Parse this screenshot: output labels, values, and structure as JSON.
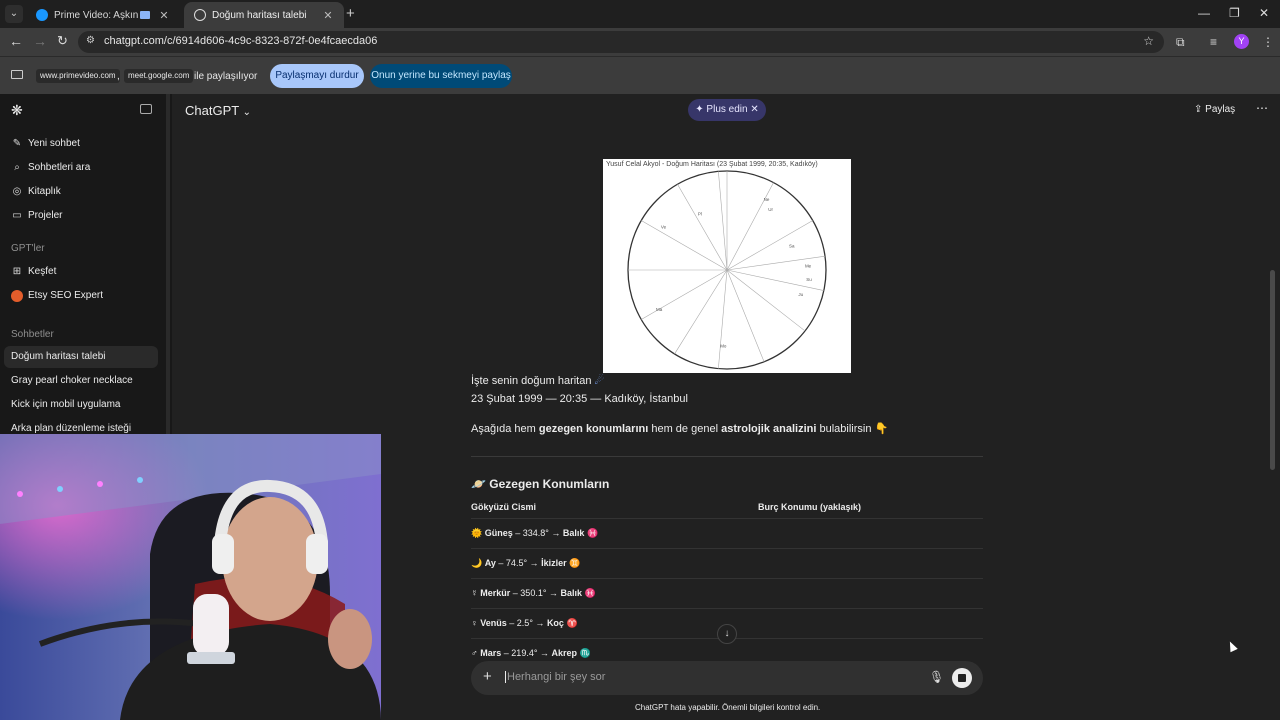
{
  "browser": {
    "tabs": [
      {
        "title": "Prime Video: Aşkın Gücü",
        "active": false
      },
      {
        "title": "Doğum haritası talebi",
        "active": true
      }
    ],
    "url": "chatgpt.com/c/6914d606-4c9c-8323-872f-0e4fcaecda06",
    "profile_initial": "Y"
  },
  "sharing": {
    "sites": [
      "www.primevideo.com",
      "meet.google.com"
    ],
    "separator": ",",
    "text": "ile paylaşılıyor",
    "stop_label": "Paylaşmayı durdur",
    "share_tab_label": "Onun yerine bu sekmeyi paylaş"
  },
  "sidebar": {
    "actions": [
      {
        "label": "Yeni sohbet",
        "icon": "edit-icon"
      },
      {
        "label": "Sohbetleri ara",
        "icon": "search-icon"
      },
      {
        "label": "Kitaplık",
        "icon": "library-icon"
      },
      {
        "label": "Projeler",
        "icon": "folder-icon"
      }
    ],
    "gpts_heading": "GPT'ler",
    "gpts": [
      {
        "label": "Keşfet",
        "icon": "grid-icon"
      },
      {
        "label": "Etsy SEO Expert",
        "icon": "etsy-icon"
      }
    ],
    "chats_heading": "Sohbetler",
    "chats": [
      {
        "label": "Doğum haritası talebi",
        "active": true
      },
      {
        "label": "Gray pearl choker necklace",
        "active": false
      },
      {
        "label": "Kick için mobil uygulama",
        "active": false
      },
      {
        "label": "Arka plan düzenleme isteği",
        "active": false
      }
    ]
  },
  "header": {
    "model": "ChatGPT",
    "plus_label": "Plus edin",
    "share_label": "Paylaş"
  },
  "chart_image": {
    "title": "Yusuf Celal Akyol - Doğum Haritası (23 Şubat 1999, 20:35, Kadıköy)",
    "planet_labels": [
      "Pl",
      "Ne",
      "Ur",
      "Sa",
      "Me",
      "Su",
      "Ju",
      "Ma",
      "Ve",
      "Mo"
    ]
  },
  "message": {
    "line1": "İşte senin doğum haritan",
    "line2": "23 Şubat 1999 — 20:35 — Kadıköy, İstanbul",
    "intro_pre": "Aşağıda hem ",
    "intro_b1": "gezegen konumlarını",
    "intro_mid": " hem de genel ",
    "intro_b2": "astrolojik analizini",
    "intro_post": " bulabilirsin 👇",
    "section_title": "🪐 Gezegen Konumların",
    "table_headers": [
      "Gökyüzü Cismi",
      "Burç Konumu (yaklaşık)"
    ],
    "rows": [
      {
        "symbol": "🌞",
        "body": "Güneş",
        "deg": "– 334.8° →",
        "sign": "Balık",
        "glyph": "♓"
      },
      {
        "symbol": "🌙",
        "body": "Ay",
        "deg": "– 74.5° →",
        "sign": "İkizler",
        "glyph": "♊"
      },
      {
        "symbol": "☿",
        "body": "Merkür",
        "deg": "– 350.1° →",
        "sign": "Balık",
        "glyph": "♓"
      },
      {
        "symbol": "♀",
        "body": "Venüs",
        "deg": "– 2.5° →",
        "sign": "Koç",
        "glyph": "♈"
      },
      {
        "symbol": "♂",
        "body": "Mars",
        "deg": "– 219.4° →",
        "sign": "Akrep",
        "glyph": "♏"
      }
    ]
  },
  "composer": {
    "placeholder": "Herhangi bir şey sor"
  },
  "disclaimer": "ChatGPT hata yapabilir. Önemli bilgileri kontrol edin."
}
